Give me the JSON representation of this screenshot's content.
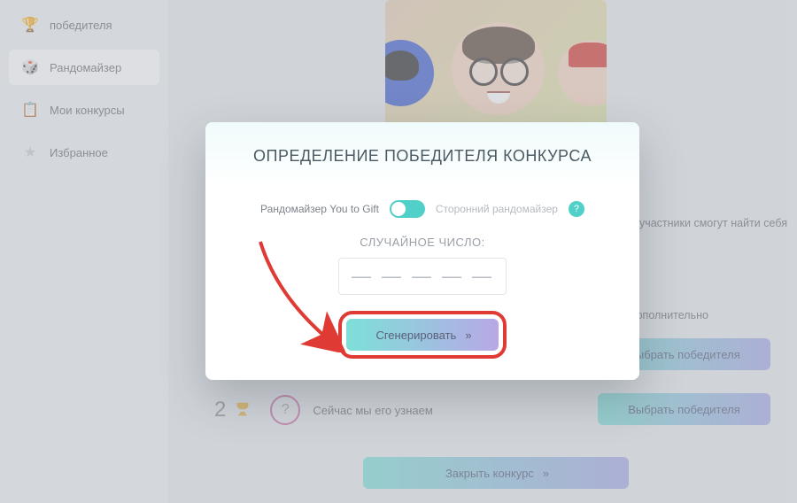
{
  "sidebar": {
    "items": [
      {
        "label": "победителя",
        "icon": "🏆"
      },
      {
        "label": "Рандомайзер",
        "icon": "🎲"
      },
      {
        "label": "Мои конкурсы",
        "icon": "📋"
      },
      {
        "label": "Избранное",
        "icon": "★"
      }
    ]
  },
  "main": {
    "info_tail": ", участники смогут найти себя в",
    "extra_link": "Дополнительно",
    "select_winner": "Выбрать победителя",
    "close_contest": "Закрыть конкурс",
    "place2": {
      "num": "2",
      "circle": "?",
      "text": "Сейчас мы его узнаем"
    }
  },
  "modal": {
    "title": "ОПРЕДЕЛЕНИЕ ПОБЕДИТЕЛЯ КОНКУРСА",
    "toggle_on_label": "Рандомайзер You to Gift",
    "toggle_off_label": "Сторонний рандомайзер",
    "help": "?",
    "random_label": "СЛУЧАЙНОЕ ЧИСЛО:",
    "placeholder_dash": "—",
    "generate": "Сгенерировать"
  },
  "glyphs": {
    "chevrons": "»"
  }
}
